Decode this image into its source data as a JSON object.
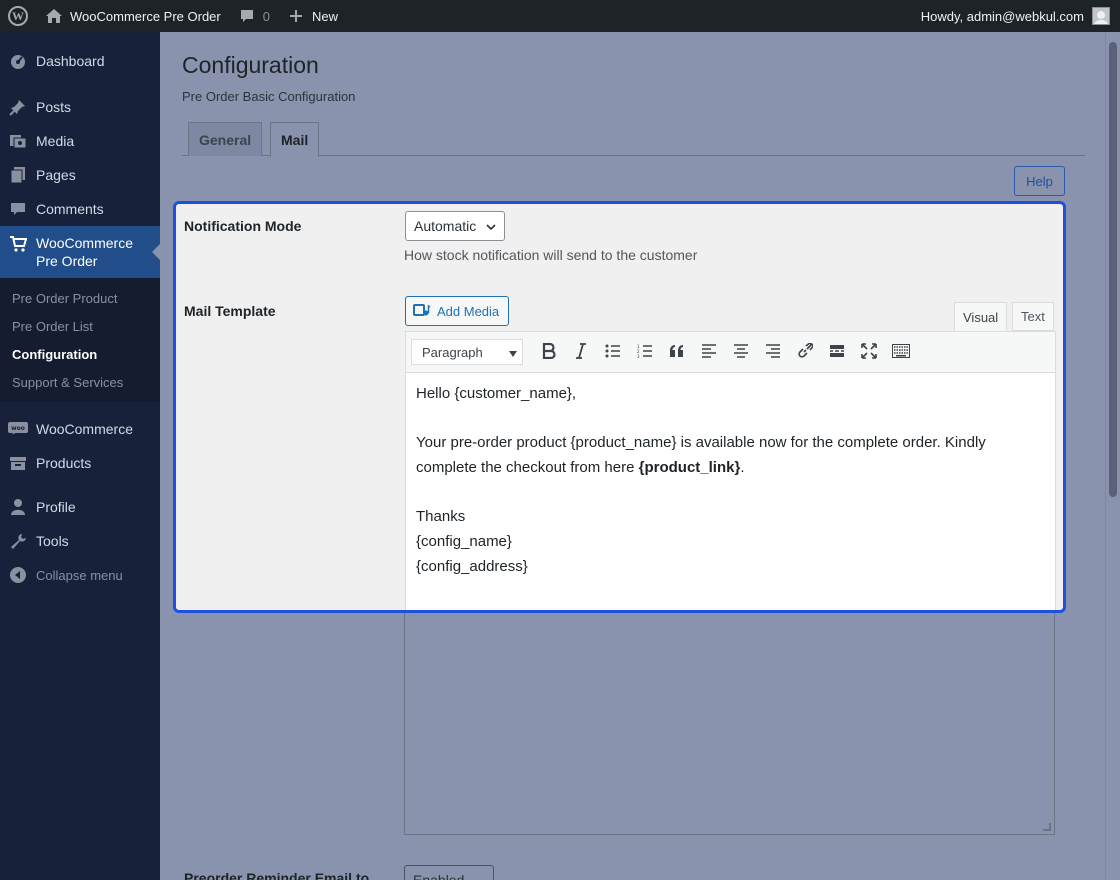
{
  "adminbar": {
    "site_name": "WooCommerce Pre Order",
    "comments_count": "0",
    "new_label": "New",
    "howdy": "Howdy, admin@webkul.com"
  },
  "sidebar": {
    "items": [
      {
        "label": "Dashboard",
        "icon": "dashboard-icon"
      },
      {
        "label": "Posts",
        "icon": "pin-icon"
      },
      {
        "label": "Media",
        "icon": "media-icon"
      },
      {
        "label": "Pages",
        "icon": "pages-icon"
      },
      {
        "label": "Comments",
        "icon": "comments-icon"
      },
      {
        "label": "WooCommerce Pre Order",
        "icon": "cart-icon"
      },
      {
        "label": "WooCommerce",
        "icon": "woo-icon"
      },
      {
        "label": "Products",
        "icon": "products-icon"
      },
      {
        "label": "Profile",
        "icon": "user-icon"
      },
      {
        "label": "Tools",
        "icon": "wrench-icon"
      },
      {
        "label": "Collapse menu",
        "icon": "collapse-icon"
      }
    ],
    "submenu": [
      "Pre Order Product",
      "Pre Order List",
      "Configuration",
      "Support & Services"
    ]
  },
  "page": {
    "title": "Configuration",
    "subtitle": "Pre Order Basic Configuration",
    "tabs": [
      "General",
      "Mail"
    ],
    "help_label": "Help"
  },
  "form": {
    "notification_mode_label": "Notification Mode",
    "notification_mode_value": "Automatic",
    "notification_mode_desc": "How stock notification will send to the customer",
    "mail_template_label": "Mail Template",
    "add_media_label": "Add Media",
    "editor_tabs": [
      "Visual",
      "Text"
    ],
    "format_value": "Paragraph",
    "reminder_label": "Preorder Reminder Email to",
    "reminder_value": "Enabled"
  },
  "mail_body": {
    "line1": "Hello {customer_name},",
    "para2_text": "Your pre-order product {product_name} is available now for the complete order. Kindly complete the checkout from here ",
    "para2_bold": "{product_link}",
    "para2_end": ".",
    "line3": "Thanks",
    "line4": "{config_name}",
    "line5": "{config_address}"
  },
  "colors": {
    "highlight_border": "#1f4fe0",
    "sidebar_bg": "#18213a",
    "active_menu": "#214e8a",
    "overlay_bg": "#8a93ad"
  }
}
